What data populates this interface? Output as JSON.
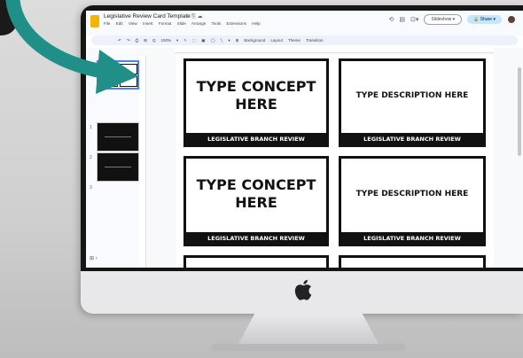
{
  "app": {
    "title": "Legislative Review Card Template",
    "title_icons": "☆ ⎘ ☁",
    "menu": [
      "File",
      "Edit",
      "View",
      "Insert",
      "Format",
      "Slide",
      "Arrange",
      "Tools",
      "Extensions",
      "Help"
    ]
  },
  "header": {
    "history_icon": "history-icon",
    "comments_icon": "comments-icon",
    "camera_icon": "camera-icon",
    "slideshow_label": "Slideshow",
    "share_label": "Share",
    "zoom": "100%"
  },
  "toolbar": {
    "items": [
      "↶",
      "↷",
      "⎙",
      "⊞",
      "Q",
      "100%",
      "▾",
      "↖",
      "⬚",
      "▣",
      "◯",
      "╲",
      "▾",
      "⊞",
      "Background",
      "Layout",
      "Theme",
      "Transition"
    ]
  },
  "filmstrip": {
    "slide_numbers": [
      "1",
      "2",
      "3"
    ]
  },
  "slide": {
    "cards": [
      {
        "text": "TYPE CONCEPT HERE",
        "banner": "LEGISLATIVE BRANCH REVIEW",
        "kind": "concept"
      },
      {
        "text": "TYPE DESCRIPTION HERE",
        "banner": "LEGISLATIVE BRANCH REVIEW",
        "kind": "description"
      },
      {
        "text": "TYPE CONCEPT HERE",
        "banner": "LEGISLATIVE BRANCH REVIEW",
        "kind": "concept"
      },
      {
        "text": "TYPE DESCRIPTION HERE",
        "banner": "LEGISLATIVE BRANCH REVIEW",
        "kind": "description"
      }
    ]
  },
  "colors": {
    "arrow": "#1f8f88",
    "accent_blue": "#4f80f0",
    "share_bg": "#c2e7ff",
    "card_border": "#111111"
  }
}
